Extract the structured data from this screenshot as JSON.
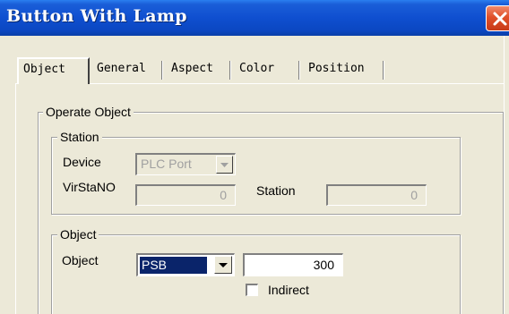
{
  "window": {
    "title": "Button With Lamp",
    "close_icon": "close-icon"
  },
  "tabs": [
    {
      "label": "Object",
      "active": true
    },
    {
      "label": "General",
      "active": false
    },
    {
      "label": "Aspect",
      "active": false
    },
    {
      "label": "Color",
      "active": false
    },
    {
      "label": "Position",
      "active": false
    }
  ],
  "operate_object": {
    "legend": "Operate Object",
    "station_group": {
      "legend": "Station",
      "device_label": "Device",
      "device_value": "PLC Port",
      "virstano_label": "VirStaNO",
      "virstano_value": "0",
      "station_label": "Station",
      "station_value": "0"
    },
    "object_group": {
      "legend": "Object",
      "object_label": "Object",
      "object_type": "PSB",
      "object_address": "300",
      "indirect_label": "Indirect",
      "indirect_checked": false
    }
  },
  "colors": {
    "titlebar": "#0b47c2",
    "dialog_bg": "#ece9d8",
    "selection": "#0a246a",
    "close_button": "#e0502a"
  }
}
